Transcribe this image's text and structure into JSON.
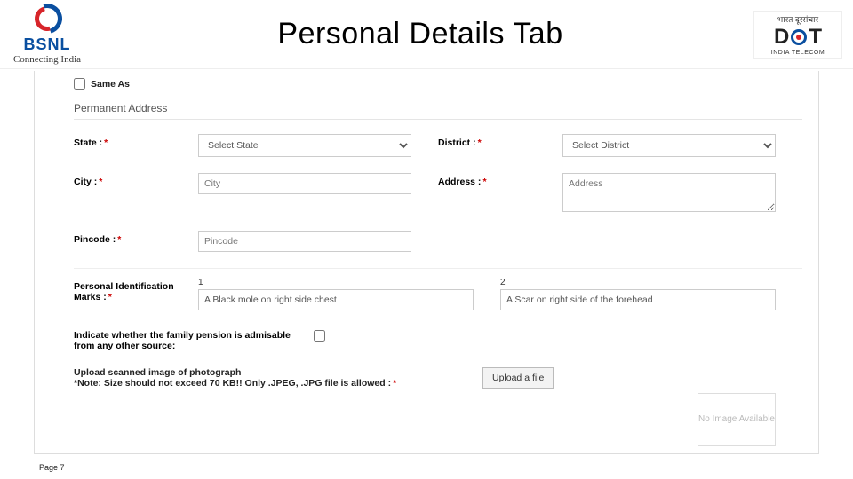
{
  "header": {
    "brand": "BSNL",
    "tagline": "Connecting India",
    "title": "Personal Details Tab",
    "bharat": "भारत दूरसंचार",
    "dot_d": "D",
    "dot_t": "T",
    "india_telecom": "INDIA TELECOM"
  },
  "form": {
    "same_as_label": "Same As",
    "section": "Permanent Address",
    "state_label": "State :",
    "state_placeholder": "Select State",
    "district_label": "District :",
    "district_placeholder": "Select District",
    "city_label": "City :",
    "city_placeholder": "City",
    "address_label": "Address :",
    "address_placeholder": "Address",
    "pincode_label": "Pincode :",
    "pincode_placeholder": "Pincode",
    "marks_label": "Personal Identification Marks :",
    "mark1_num": "1",
    "mark2_num": "2",
    "mark1_value": "A Black mole on right side chest",
    "mark2_value": "A Scar on right side of the forehead",
    "pension_label": "Indicate whether the family pension is admisable from any other source:",
    "upload_label": "Upload scanned image of photograph",
    "upload_note": "*Note: Size should not exceed 70 KB!! Only .JPEG, .JPG file is allowed :",
    "upload_button": "Upload a file",
    "no_image": "No Image Available",
    "asterisk": "*"
  },
  "footer": {
    "page": "Page 7"
  }
}
